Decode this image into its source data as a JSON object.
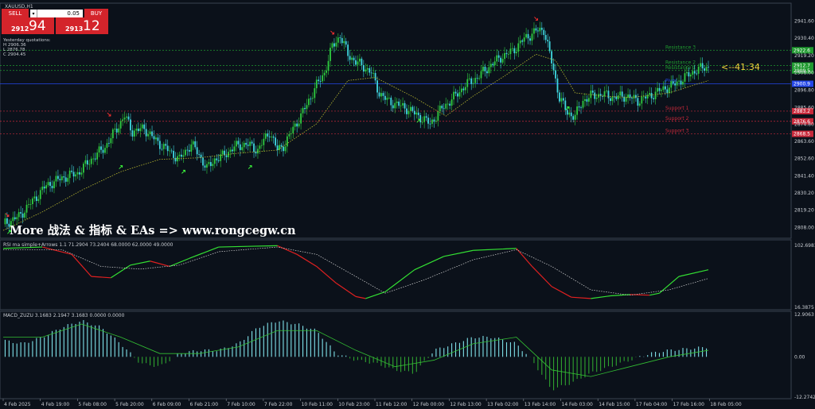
{
  "symbol_title": "XAUUSD,H1",
  "trade_panel": {
    "sell_label": "SELL",
    "buy_label": "BUY",
    "lot": "0.05",
    "bid_small": "2912",
    "bid_big": "94",
    "ask_small": "2913",
    "ask_big": "12"
  },
  "quotes": {
    "title": "Yesterday quotations:",
    "high": "H 2906.36",
    "low": "L 2876.78",
    "close": "C 2904.45"
  },
  "watermark": "More 战法 & 指标 & EAs => www.rongcegw.cn",
  "countdown": "<--41:34",
  "colors": {
    "background": "#0b111a",
    "bull_candle": "#2ecc40",
    "bear_candle": "#3fd8e0",
    "ma_line": "#b8b830",
    "resistance": "#1f9a2f",
    "pivot": "#2447e8",
    "support": "#c8283a",
    "rsi_up": "#33e033",
    "rsi_down": "#e02020",
    "macd_hist": "#7ee0e8",
    "macd_neg": "#2fa22f"
  },
  "chart_data": [
    {
      "type": "candlestick",
      "name": "XAUUSD,H1",
      "ylim": [
        2803,
        2951
      ],
      "y_ticks": [
        "2941.60",
        "2930.40",
        "2919.20",
        "2908.00",
        "2896.80",
        "2885.60",
        "2874.80",
        "2863.60",
        "2852.60",
        "2841.40",
        "2830.20",
        "2819.20",
        "2808.00"
      ],
      "x_tick_labels": [
        "4 Feb 2025",
        "4 Feb 19:00",
        "5 Feb 08:00",
        "5 Feb 20:00",
        "6 Feb 09:00",
        "6 Feb 21:00",
        "7 Feb 10:00",
        "7 Feb 22:00",
        "10 Feb 11:00",
        "10 Feb 23:00",
        "11 Feb 12:00",
        "12 Feb 00:00",
        "12 Feb 13:00",
        "13 Feb 02:00",
        "13 Feb 14:00",
        "14 Feb 03:00",
        "14 Feb 15:00",
        "17 Feb 04:00",
        "17 Feb 16:00",
        "18 Feb 05:00"
      ],
      "path_close": [
        [
          0,
          2810
        ],
        [
          8,
          2815
        ],
        [
          15,
          2825
        ],
        [
          22,
          2835
        ],
        [
          30,
          2840
        ],
        [
          38,
          2843
        ],
        [
          45,
          2852
        ],
        [
          52,
          2860
        ],
        [
          58,
          2872
        ],
        [
          62,
          2880
        ],
        [
          66,
          2870
        ],
        [
          72,
          2872
        ],
        [
          78,
          2864
        ],
        [
          84,
          2858
        ],
        [
          90,
          2852
        ],
        [
          96,
          2862
        ],
        [
          100,
          2855
        ],
        [
          104,
          2846
        ],
        [
          108,
          2852
        ],
        [
          112,
          2854
        ],
        [
          118,
          2860
        ],
        [
          124,
          2862
        ],
        [
          130,
          2858
        ],
        [
          136,
          2870
        ],
        [
          140,
          2858
        ],
        [
          144,
          2862
        ],
        [
          148,
          2872
        ],
        [
          152,
          2880
        ],
        [
          156,
          2890
        ],
        [
          160,
          2900
        ],
        [
          164,
          2908
        ],
        [
          168,
          2925
        ],
        [
          172,
          2932
        ],
        [
          176,
          2920
        ],
        [
          180,
          2915
        ],
        [
          184,
          2912
        ],
        [
          188,
          2908
        ],
        [
          192,
          2895
        ],
        [
          196,
          2890
        ],
        [
          200,
          2888
        ],
        [
          206,
          2885
        ],
        [
          212,
          2880
        ],
        [
          218,
          2875
        ],
        [
          224,
          2885
        ],
        [
          230,
          2892
        ],
        [
          236,
          2900
        ],
        [
          242,
          2905
        ],
        [
          248,
          2912
        ],
        [
          254,
          2918
        ],
        [
          260,
          2922
        ],
        [
          266,
          2930
        ],
        [
          272,
          2935
        ],
        [
          276,
          2936
        ],
        [
          280,
          2915
        ],
        [
          284,
          2892
        ],
        [
          288,
          2882
        ],
        [
          292,
          2880
        ],
        [
          296,
          2890
        ],
        [
          300,
          2893
        ],
        [
          306,
          2894
        ],
        [
          312,
          2892
        ],
        [
          318,
          2893
        ],
        [
          324,
          2890
        ],
        [
          330,
          2893
        ],
        [
          336,
          2897
        ],
        [
          342,
          2900
        ],
        [
          348,
          2905
        ],
        [
          354,
          2910
        ],
        [
          360,
          2912
        ]
      ],
      "ma_path": [
        [
          0,
          2806
        ],
        [
          20,
          2818
        ],
        [
          40,
          2832
        ],
        [
          60,
          2844
        ],
        [
          80,
          2852
        ],
        [
          100,
          2853
        ],
        [
          120,
          2856
        ],
        [
          140,
          2858
        ],
        [
          160,
          2875
        ],
        [
          176,
          2903
        ],
        [
          190,
          2905
        ],
        [
          210,
          2892
        ],
        [
          226,
          2880
        ],
        [
          240,
          2893
        ],
        [
          256,
          2906
        ],
        [
          272,
          2920
        ],
        [
          282,
          2916
        ],
        [
          292,
          2895
        ],
        [
          306,
          2893
        ],
        [
          320,
          2892
        ],
        [
          340,
          2895
        ],
        [
          360,
          2903
        ]
      ],
      "levels": [
        {
          "name": "Resistance 3",
          "value": 2922.6,
          "label_color": "resistance",
          "tag": "2922.6"
        },
        {
          "name": "Resistance 2",
          "value": 2912.7,
          "label_color": "resistance",
          "tag": "2912.7"
        },
        {
          "name": "Resistance 1",
          "value": 2909.5,
          "label_color": "resistance",
          "tag": "2909.5"
        },
        {
          "name": "Pivot",
          "value": 2900.9,
          "label_color": "pivot",
          "tag": "2900.9"
        },
        {
          "name": "Support 1",
          "value": 2883.2,
          "label_color": "support",
          "tag": "2883.2"
        },
        {
          "name": "Support 2",
          "value": 2876.6,
          "label_color": "support",
          "tag": "2876.6"
        },
        {
          "name": "Support 3",
          "value": 2868.5,
          "label_color": "support",
          "tag": "2868.5"
        }
      ],
      "up_arrows": [
        [
          3,
          2808
        ],
        [
          60,
          2850
        ],
        [
          92,
          2847
        ],
        [
          126,
          2850
        ],
        [
          212,
          2880
        ],
        [
          288,
          2888
        ]
      ],
      "down_arrows": [
        [
          2,
          2813
        ],
        [
          54,
          2878
        ],
        [
          168,
          2931
        ],
        [
          272,
          2940
        ]
      ]
    },
    {
      "type": "line",
      "name": "RSI ma simple+Arrows 1.1 71.2904 73.2404 68.0000 62.0000 49.0000",
      "ylim": [
        16.3875,
        102.6981
      ],
      "y_ticks": [
        "102.6981",
        "16.3875"
      ],
      "rsi_path": [
        [
          0,
          97
        ],
        [
          20,
          99
        ],
        [
          35,
          88
        ],
        [
          45,
          55
        ],
        [
          55,
          53
        ],
        [
          65,
          72
        ],
        [
          75,
          78
        ],
        [
          85,
          70
        ],
        [
          95,
          82
        ],
        [
          110,
          99
        ],
        [
          125,
          100
        ],
        [
          140,
          101
        ],
        [
          150,
          88
        ],
        [
          160,
          70
        ],
        [
          170,
          45
        ],
        [
          180,
          25
        ],
        [
          185,
          22
        ],
        [
          195,
          32
        ],
        [
          210,
          65
        ],
        [
          225,
          85
        ],
        [
          240,
          94
        ],
        [
          255,
          96
        ],
        [
          262,
          97
        ],
        [
          270,
          70
        ],
        [
          280,
          40
        ],
        [
          290,
          24
        ],
        [
          300,
          22
        ],
        [
          310,
          26
        ],
        [
          320,
          28
        ],
        [
          330,
          27
        ],
        [
          335,
          30
        ],
        [
          345,
          55
        ],
        [
          360,
          65
        ]
      ],
      "rsi_signal": [
        [
          0,
          95
        ],
        [
          30,
          95
        ],
        [
          50,
          70
        ],
        [
          70,
          66
        ],
        [
          90,
          72
        ],
        [
          110,
          92
        ],
        [
          140,
          99
        ],
        [
          160,
          88
        ],
        [
          180,
          55
        ],
        [
          195,
          30
        ],
        [
          215,
          50
        ],
        [
          240,
          80
        ],
        [
          262,
          95
        ],
        [
          280,
          70
        ],
        [
          300,
          35
        ],
        [
          320,
          27
        ],
        [
          340,
          35
        ],
        [
          360,
          52
        ]
      ]
    },
    {
      "type": "bar",
      "name": "MACD_ZUZU 3.1683 2.1947 3.1683 0.0000 0.0000",
      "ylim": [
        -12.2742,
        12.9063
      ],
      "y_ticks": [
        "12.9063",
        "0.00",
        "-12.2742"
      ],
      "hist": [
        [
          0,
          5
        ],
        [
          10,
          4
        ],
        [
          20,
          6
        ],
        [
          30,
          9
        ],
        [
          40,
          11
        ],
        [
          50,
          9
        ],
        [
          60,
          4
        ],
        [
          70,
          -2
        ],
        [
          80,
          -3
        ],
        [
          90,
          1
        ],
        [
          100,
          2
        ],
        [
          110,
          2
        ],
        [
          120,
          4
        ],
        [
          130,
          9
        ],
        [
          140,
          11
        ],
        [
          150,
          10
        ],
        [
          160,
          8
        ],
        [
          170,
          1
        ],
        [
          180,
          -1
        ],
        [
          190,
          -2
        ],
        [
          200,
          -4
        ],
        [
          210,
          -5
        ],
        [
          220,
          2
        ],
        [
          230,
          4
        ],
        [
          240,
          6
        ],
        [
          250,
          6
        ],
        [
          262,
          4
        ],
        [
          270,
          -1
        ],
        [
          280,
          -10
        ],
        [
          290,
          -8
        ],
        [
          300,
          -5
        ],
        [
          310,
          -3
        ],
        [
          320,
          -1
        ],
        [
          330,
          1
        ],
        [
          340,
          2
        ],
        [
          350,
          2.5
        ],
        [
          360,
          3
        ]
      ],
      "signal": [
        [
          0,
          6
        ],
        [
          20,
          6
        ],
        [
          40,
          10
        ],
        [
          60,
          6
        ],
        [
          80,
          1
        ],
        [
          100,
          1
        ],
        [
          120,
          3
        ],
        [
          140,
          8
        ],
        [
          160,
          8
        ],
        [
          180,
          2
        ],
        [
          200,
          -3
        ],
        [
          220,
          -1
        ],
        [
          240,
          4
        ],
        [
          262,
          6
        ],
        [
          280,
          -4
        ],
        [
          300,
          -6
        ],
        [
          320,
          -3
        ],
        [
          340,
          0
        ],
        [
          360,
          2
        ]
      ]
    }
  ]
}
